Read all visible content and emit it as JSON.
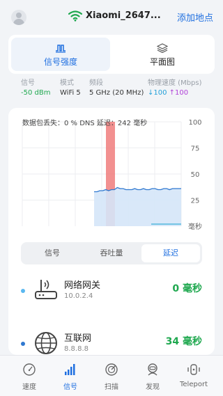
{
  "header": {
    "ssid": "Xiaomi_2647...",
    "add_location": "添加地点"
  },
  "top_tabs": [
    {
      "label": "信号强度",
      "icon": "signal-strength-icon",
      "active": true
    },
    {
      "label": "平面图",
      "icon": "layers-icon",
      "active": false
    }
  ],
  "stats": {
    "signal": {
      "label": "信号",
      "value": "-50 dBm"
    },
    "mode": {
      "label": "模式",
      "value": "WiFi 5"
    },
    "band": {
      "label": "频段",
      "value": "5 GHz (20 MHz)"
    },
    "rate": {
      "label": "物理速度 (Mbps)",
      "down": "↓100",
      "up": "↑100"
    }
  },
  "chart_label": "数据包丢失：0 %  DNS 延迟：242 毫秒",
  "chart_data": {
    "type": "area",
    "y_ticks": [
      "100",
      "75",
      "50",
      "25",
      "毫秒"
    ],
    "ylim": [
      0,
      100
    ],
    "series": [
      {
        "values": [
          33,
          33,
          34,
          34,
          35,
          34,
          35,
          35,
          37,
          36,
          36,
          35,
          35,
          35,
          36,
          35,
          35,
          36,
          35,
          35,
          36,
          36,
          35,
          35,
          36,
          36,
          35,
          36,
          36,
          36,
          36
        ]
      },
      {
        "values": [
          2,
          2,
          2,
          2,
          2,
          2,
          2,
          2,
          2,
          2,
          2,
          2,
          2
        ]
      }
    ],
    "loss_highlight": true,
    "colors": {
      "line": "#2f78d0",
      "fill": "#d5e5f8",
      "loss": "#f07d7d",
      "secondary": "#3aaed8"
    }
  },
  "segment": [
    {
      "label": "信号",
      "active": false
    },
    {
      "label": "吞吐量",
      "active": false
    },
    {
      "label": "延迟",
      "active": true
    }
  ],
  "targets": [
    {
      "name": "网络网关",
      "ip": "10.0.2.4",
      "latency": "0 毫秒",
      "dot": "#5ab8f0",
      "icon": "router-icon"
    },
    {
      "name": "互联网",
      "ip": "8.8.8.8",
      "latency": "34 毫秒",
      "dot": "#2f78d0",
      "icon": "globe-icon"
    }
  ],
  "nav": [
    {
      "label": "速度",
      "icon": "speedometer-icon",
      "active": false
    },
    {
      "label": "信号",
      "icon": "signal-bars-icon",
      "active": true
    },
    {
      "label": "扫描",
      "icon": "radar-icon",
      "active": false
    },
    {
      "label": "发现",
      "icon": "discover-icon",
      "active": false
    },
    {
      "label": "Teleport",
      "icon": "teleport-icon",
      "active": false
    }
  ],
  "colors": {
    "accent": "#1f6fe0",
    "good": "#1fa84f"
  }
}
